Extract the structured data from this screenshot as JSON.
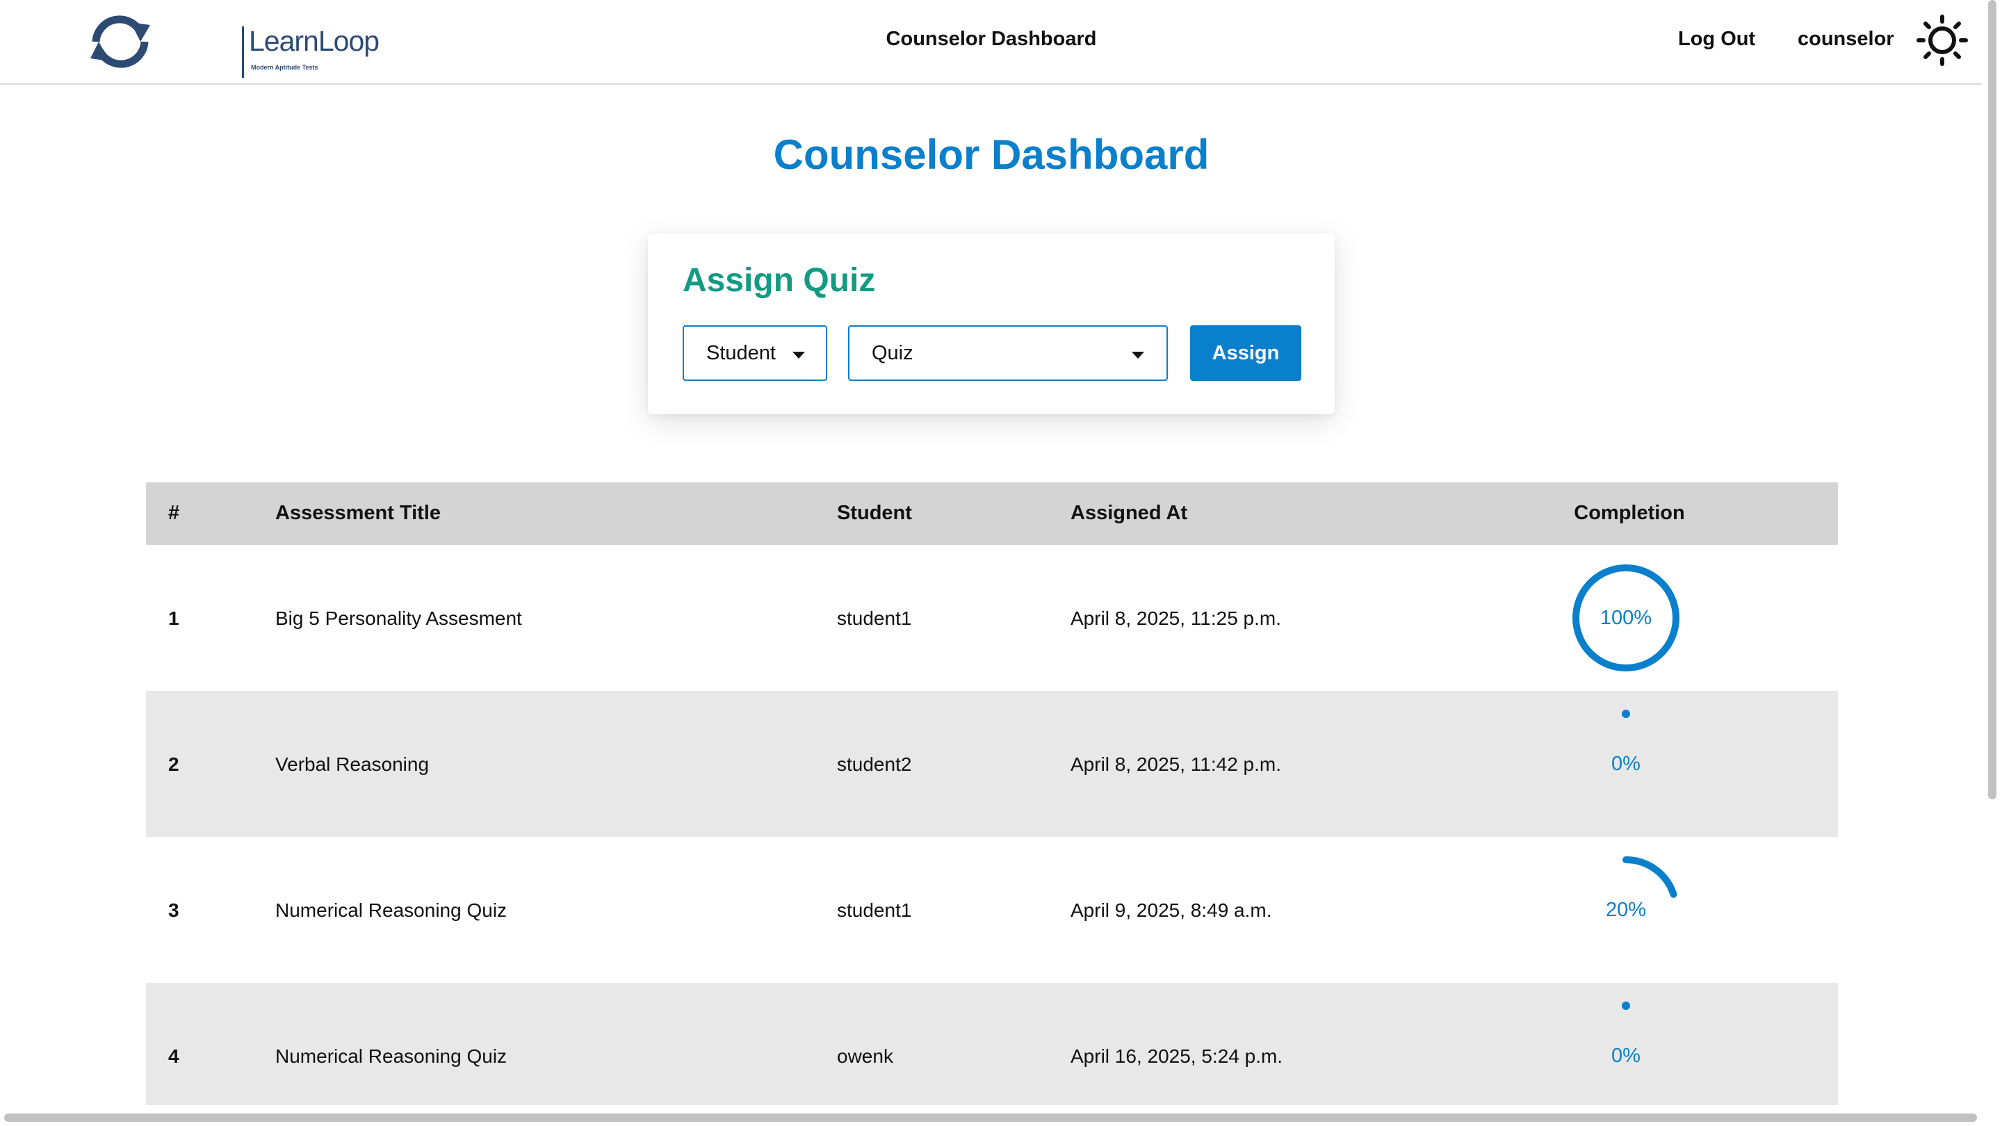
{
  "brand": {
    "name": "LearnLoop",
    "tagline": "Modern Aptitude Tests"
  },
  "nav": {
    "title": "Counselor Dashboard",
    "logout": "Log Out",
    "user": "counselor",
    "theme_icon": "sun-icon"
  },
  "page": {
    "title": "Counselor Dashboard"
  },
  "assign": {
    "title": "Assign Quiz",
    "student_select": "Student",
    "quiz_select": "Quiz",
    "button": "Assign"
  },
  "table": {
    "headers": [
      "#",
      "Assessment Title",
      "Student",
      "Assigned At",
      "Completion"
    ],
    "rows": [
      {
        "num": "1",
        "title": "Big 5 Personality Assesment",
        "student": "student1",
        "assigned_at": "April 8, 2025, 11:25 p.m.",
        "completion": 100,
        "completion_label": "100%"
      },
      {
        "num": "2",
        "title": "Verbal Reasoning",
        "student": "student2",
        "assigned_at": "April 8, 2025, 11:42 p.m.",
        "completion": 0,
        "completion_label": "0%"
      },
      {
        "num": "3",
        "title": "Numerical Reasoning Quiz",
        "student": "student1",
        "assigned_at": "April 9, 2025, 8:49 a.m.",
        "completion": 20,
        "completion_label": "20%"
      },
      {
        "num": "4",
        "title": "Numerical Reasoning Quiz",
        "student": "owenk",
        "assigned_at": "April 16, 2025, 5:24 p.m.",
        "completion": 0,
        "completion_label": "0%"
      }
    ]
  },
  "colors": {
    "accent": "#0a7fcc",
    "card_title": "#129b82",
    "header_bg": "#d4d4d4",
    "alt_row": "#e8e8e8"
  }
}
